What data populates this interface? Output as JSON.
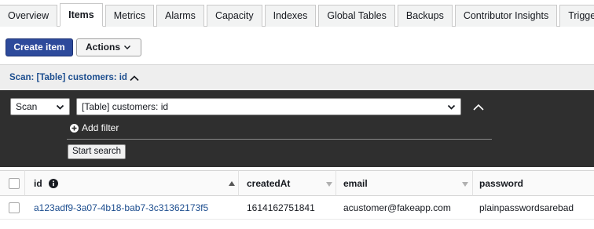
{
  "tabs": [
    {
      "label": "Overview",
      "active": false
    },
    {
      "label": "Items",
      "active": true
    },
    {
      "label": "Metrics",
      "active": false
    },
    {
      "label": "Alarms",
      "active": false
    },
    {
      "label": "Capacity",
      "active": false
    },
    {
      "label": "Indexes",
      "active": false
    },
    {
      "label": "Global Tables",
      "active": false
    },
    {
      "label": "Backups",
      "active": false
    },
    {
      "label": "Contributor Insights",
      "active": false
    },
    {
      "label": "Triggers",
      "active": false
    }
  ],
  "toolbar": {
    "create_label": "Create item",
    "actions_label": "Actions"
  },
  "scan": {
    "title": "Scan: [Table] customers: id",
    "mode_value": "Scan",
    "table_value": "[Table] customers: id",
    "add_filter_label": "Add filter",
    "start_search_label": "Start search"
  },
  "table": {
    "columns": [
      "id",
      "createdAt",
      "email",
      "password"
    ],
    "rows": [
      {
        "id": "a123adf9-3a07-4b18-bab7-3c31362173f5",
        "createdAt": "1614162751841",
        "email": "acustomer@fakeapp.com",
        "password": "plainpasswordsarebad"
      }
    ]
  },
  "colors": {
    "primary": "#2d4a9b",
    "link": "#1d4e8f",
    "panel": "#2f2f2f"
  }
}
